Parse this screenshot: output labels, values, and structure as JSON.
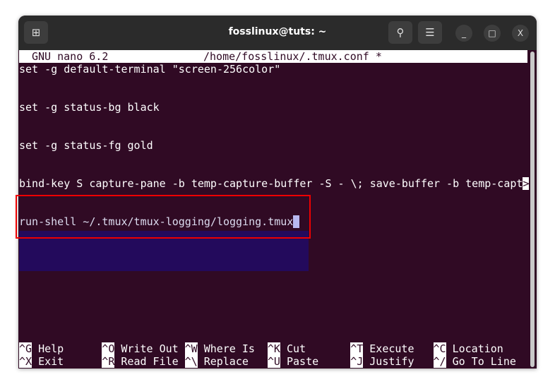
{
  "window": {
    "title": "fosslinux@tuts: ~",
    "icons": [
      "new-tab-icon",
      "search-icon",
      "menu-icon",
      "minimize-icon",
      "maximize-icon",
      "close-icon"
    ],
    "close_glyph": "X"
  },
  "nano": {
    "version": "GNU nano 6.2",
    "file": "/home/fosslinux/.tmux.conf *",
    "lines": [
      "set -g default-terminal \"screen-256color\"",
      "set -g status-bg black",
      "set -g status-fg gold",
      "bind-key S capture-pane -b temp-capture-buffer -S - \\; save-buffer -b temp-capt",
      "run-shell ~/.tmux/tmux-logging/logging.tmux"
    ],
    "overflow_marker": ">",
    "shortcuts": [
      [
        {
          "key": "^G",
          "label": "Help"
        },
        {
          "key": "^O",
          "label": "Write Out"
        },
        {
          "key": "^W",
          "label": "Where Is"
        },
        {
          "key": "^K",
          "label": "Cut"
        },
        {
          "key": "^T",
          "label": "Execute"
        },
        {
          "key": "^C",
          "label": "Location"
        }
      ],
      [
        {
          "key": "^X",
          "label": "Exit"
        },
        {
          "key": "^R",
          "label": "Read File"
        },
        {
          "key": "^\\",
          "label": "Replace"
        },
        {
          "key": "^U",
          "label": "Paste"
        },
        {
          "key": "^J",
          "label": "Justify"
        },
        {
          "key": "^/",
          "label": "Go To Line"
        }
      ]
    ]
  },
  "colors": {
    "terminal_bg": "#300a24",
    "highlight_bg": "#230a5c",
    "annotation": "#e00000"
  }
}
